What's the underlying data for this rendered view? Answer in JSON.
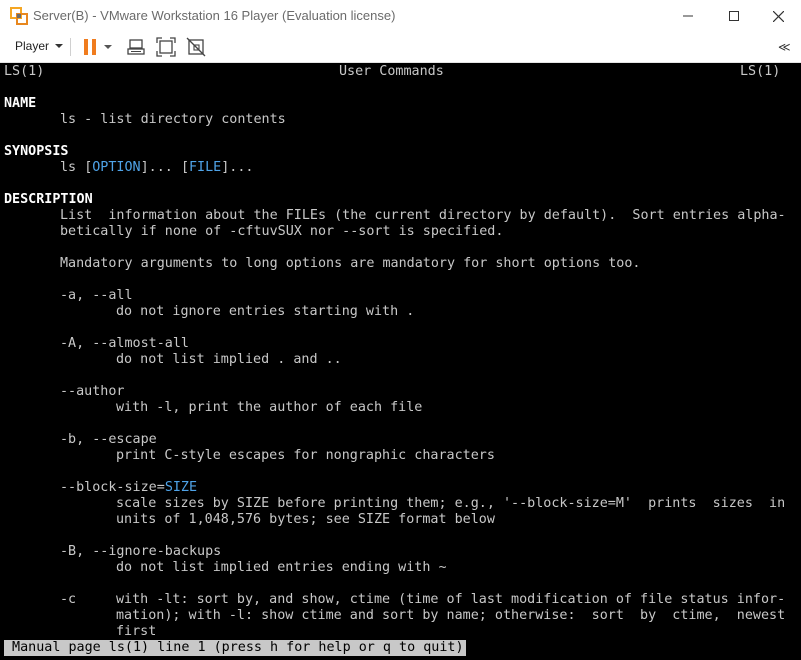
{
  "window": {
    "title": "Server(B) - VMware Workstation 16 Player (Evaluation license)",
    "app_icon": "vmware-icon",
    "controls": [
      "minimize-icon",
      "maximize-icon",
      "close-icon"
    ]
  },
  "toolbar": {
    "player_menu_label": "Player",
    "icons": [
      "pause-icon",
      "send-ctrl-alt-del-icon",
      "fit-guest-icon",
      "unity-icon"
    ],
    "collapse_label": "≪"
  },
  "colors": {
    "console_bg": "#000000",
    "console_text": "#c8c8c8",
    "console_bold": "#ffffff",
    "console_underline": "#4fa3e8",
    "pause_orange": "#f07c1e",
    "status_bg": "#c8c8c8"
  },
  "console": {
    "header_left": "LS(1)",
    "header_center": "User Commands",
    "header_right": "LS(1)",
    "name_heading": "NAME",
    "name_text": "ls - list directory contents",
    "synopsis_heading": "SYNOPSIS",
    "synopsis_cmd": "ls ",
    "synopsis_open1": "[",
    "synopsis_option": "OPTION",
    "synopsis_close1": "]... ",
    "synopsis_open2": "[",
    "synopsis_file": "FILE",
    "synopsis_close2": "]...",
    "description_heading": "DESCRIPTION",
    "desc_line1": "List  information about the FILEs (the current directory by default).  Sort entries alpha-",
    "desc_line2": "betically if none of -cftuvSUX nor --sort is specified.",
    "desc_line3": "Mandatory arguments to long options are mandatory for short options too.",
    "opt_all": "-a, --all",
    "opt_all_desc": "do not ignore entries starting with .",
    "opt_almost_all": "-A, --almost-all",
    "opt_almost_all_desc": "do not list implied . and ..",
    "opt_author": "--author",
    "opt_author_desc": "with -l, print the author of each file",
    "opt_escape": "-b, --escape",
    "opt_escape_desc": "print C-style escapes for nongraphic characters",
    "opt_block_size": "--block-size=",
    "opt_block_size_arg": "SIZE",
    "opt_block_size_desc1": "scale sizes by SIZE before printing them; e.g., '--block-size=M'  prints  sizes  in",
    "opt_block_size_desc2": "units of 1,048,576 bytes; see SIZE format below",
    "opt_ignore_backups": "-B, --ignore-backups",
    "opt_ignore_backups_desc": "do not list implied entries ending with ~",
    "opt_c": "-c",
    "opt_c_desc1": "with -lt: sort by, and show, ctime (time of last modification of file status infor-",
    "opt_c_desc2": "mation); with -l: show ctime and sort by name; otherwise:  sort  by  ctime,  newest",
    "opt_c_desc3": "first",
    "status_line": " Manual page ls(1) line 1 (press h for help or q to quit)"
  }
}
